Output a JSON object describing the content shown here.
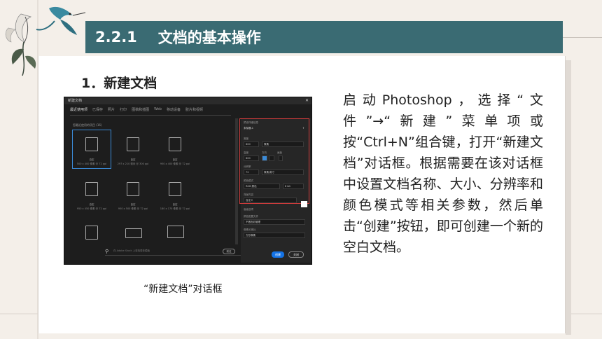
{
  "header": {
    "section_number": "2.2.1",
    "section_title": "文档的基本操作"
  },
  "subheading": "1．新建文档",
  "caption": "“新建文档”对话框",
  "body_text": "启动Photoshop，选择“文件”→“新建”菜单项或按“Ctrl+N”组合键，打开“新建文档”对话框。根据需要在该对话框中设置文档名称、大小、分辨率和颜色模式等相关参数，然后单击“创建”按钮，即可创建一个新的空白文档。",
  "dialog": {
    "title": "新建文档",
    "close": "✕",
    "tabs": [
      "最近使用项",
      "已保存",
      "照片",
      "打印",
      "图稿和插图",
      "Web",
      "移动设备",
      "胶片和视频"
    ],
    "recent_label": "您最近使用的项目 (16)",
    "tiles": [
      {
        "name": "自定",
        "size": "500 x 400 像素 @ 72 ppi"
      },
      {
        "name": "自定",
        "size": "297 x 210 毫米 @ 300 ppi"
      },
      {
        "name": "自定",
        "size": "950 x 400 像素 @ 72 ppi"
      },
      {
        "name": "自定",
        "size": "950 x 450 像素 @ 72 ppi"
      },
      {
        "name": "自定",
        "size": "950 x 500 像素 @ 72 ppi"
      },
      {
        "name": "自定",
        "size": "180 x 170 像素 @ 72 ppi"
      },
      {
        "name": "",
        "size": ""
      },
      {
        "name": "",
        "size": ""
      },
      {
        "name": "",
        "size": ""
      }
    ],
    "search_placeholder": "在 Adobe Stock 上查找更多模板",
    "search_button": "前往",
    "right": {
      "preset_label": "预设详细信息",
      "doc_name": "未标题-1",
      "width_label": "宽度",
      "width_value": "800",
      "width_unit": "像素",
      "height_label": "高度",
      "height_value": "800",
      "orientation_label": "方向",
      "artboard_label": "画板",
      "resolution_label": "分辨率",
      "resolution_value": "72",
      "resolution_unit": "像素/英寸",
      "color_mode_label": "颜色模式",
      "color_mode_value": "RGB 颜色",
      "bit_depth": "8 bit",
      "bg_label": "背景内容",
      "bg_value": "自定义",
      "advanced_label": "高级选项",
      "profile_label": "颜色配置文件",
      "profile_value": "不做色彩管理",
      "pixel_ratio_label": "像素长宽比",
      "pixel_ratio_value": "方形像素",
      "create_button": "创建",
      "close_button": "关闭"
    }
  },
  "colors": {
    "header_bg": "#3a6b73",
    "accent_blue": "#1473e6",
    "highlight_red": "#d23c3c"
  }
}
